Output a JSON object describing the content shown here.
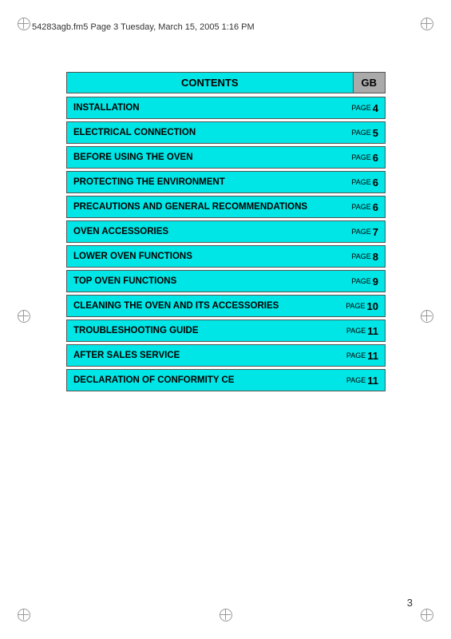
{
  "header": {
    "text": "54283agb.fm5  Page 3  Tuesday, March 15, 2005  1:16 PM"
  },
  "contents": {
    "title": "CONTENTS",
    "gb_label": "GB",
    "rows": [
      {
        "title": "INSTALLATION",
        "page_word": "PAGE",
        "page_num": "4"
      },
      {
        "title": "ELECTRICAL CONNECTION",
        "page_word": "PAGE",
        "page_num": "5"
      },
      {
        "title": "BEFORE USING THE OVEN",
        "page_word": "PAGE",
        "page_num": "6"
      },
      {
        "title": "PROTECTING THE ENVIRONMENT",
        "page_word": "PAGE",
        "page_num": "6"
      },
      {
        "title": "PRECAUTIONS AND GENERAL RECOMMENDATIONS",
        "page_word": "PAGE",
        "page_num": "6"
      },
      {
        "title": "OVEN ACCESSORIES",
        "page_word": "PAGE",
        "page_num": "7"
      },
      {
        "title": "LOWER OVEN FUNCTIONS",
        "page_word": "PAGE",
        "page_num": "8"
      },
      {
        "title": "TOP OVEN FUNCTIONS",
        "page_word": "PAGE",
        "page_num": "9"
      },
      {
        "title": "CLEANING THE OVEN AND ITS ACCESSORIES",
        "page_word": "PAGE",
        "page_num": "10"
      },
      {
        "title": "TROUBLESHOOTING GUIDE",
        "page_word": "PAGE",
        "page_num": "11"
      },
      {
        "title": "AFTER SALES SERVICE",
        "page_word": "PAGE",
        "page_num": "11"
      },
      {
        "title": "DECLARATION OF CONFORMITY CE",
        "page_word": "PAGE",
        "page_num": "11"
      }
    ]
  },
  "page_number": "3"
}
